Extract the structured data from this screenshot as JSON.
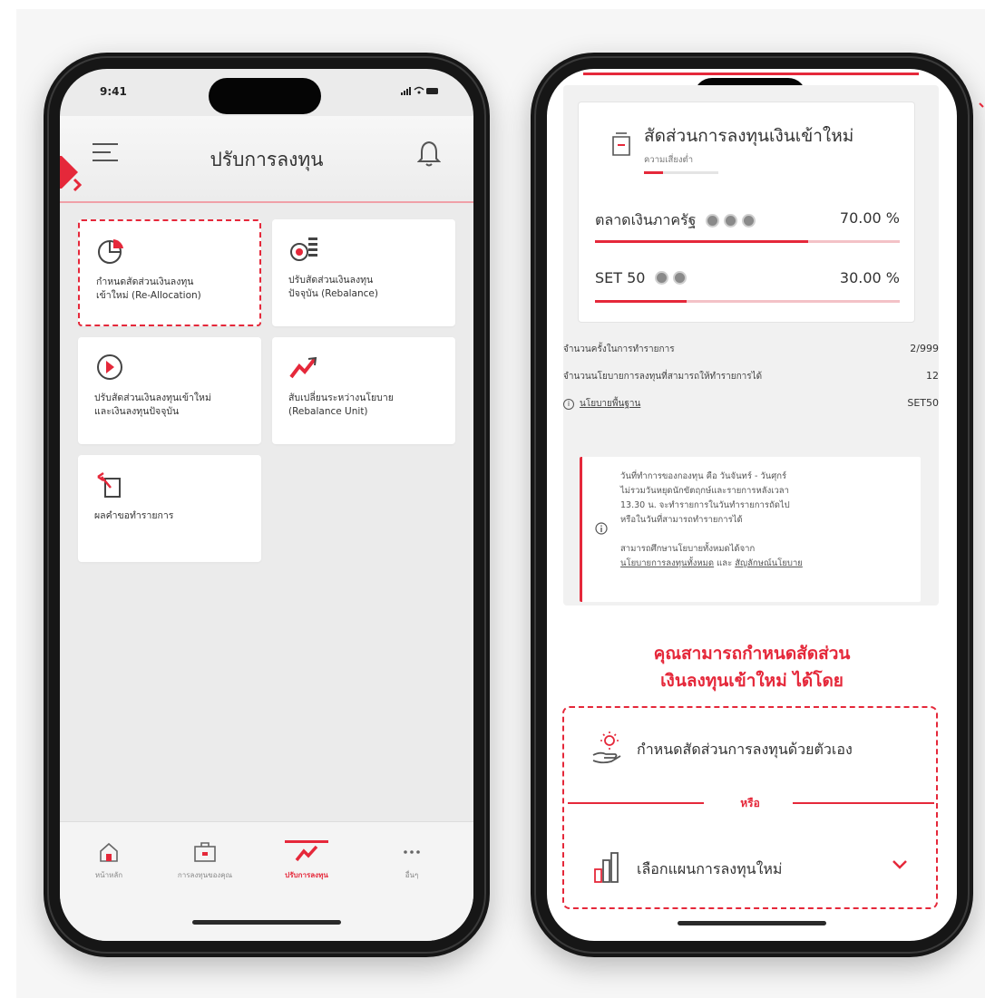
{
  "left_phone": {
    "status_time": "9:41",
    "header_title": "ปรับการลงทุน",
    "tiles": [
      {
        "label_line1": "กำหนดสัดส่วนเงินลงทุน",
        "label_line2": "เข้าใหม่ (Re-Allocation)"
      },
      {
        "label_line1": "ปรับสัดส่วนเงินลงทุน",
        "label_line2": "ปัจจุบัน (Rebalance)"
      },
      {
        "label_line1": "ปรับสัดส่วนเงินลงทุนเข้าใหม่",
        "label_line2": "และเงินลงทุนปัจจุบัน"
      },
      {
        "label_line1": "สับเปลี่ยนระหว่างนโยบาย",
        "label_line2": "(Rebalance Unit)"
      },
      {
        "label_line1": "ผลคำขอทำรายการ",
        "label_line2": ""
      }
    ],
    "nav": [
      {
        "label": "หน้าหลัก"
      },
      {
        "label": "การลงทุนของคุณ"
      },
      {
        "label": "ปรับการลงทุน"
      },
      {
        "label": "อื่นๆ"
      }
    ]
  },
  "right_phone": {
    "card_title": "สัดส่วนการลงทุนเงินเข้าใหม่",
    "card_subtitle": "ความเสี่ยงต่ำ",
    "risk_level": 0.25,
    "funds": [
      {
        "name": "ตลาดเงินภาครัฐ",
        "percent_text": "70.00 %",
        "percent": 70,
        "badges": 3
      },
      {
        "name": "SET 50",
        "percent_text": "30.00 %",
        "percent": 30,
        "badges": 2
      }
    ],
    "stats": [
      {
        "label": "จำนวนครั้งในการทำรายการ",
        "value": "2/999"
      },
      {
        "label": "จำนวนนโยบายการลงทุนที่สามารถให้ทำรายการได้",
        "value": "12"
      },
      {
        "label": "นโยบายพื้นฐาน",
        "value": "SET50"
      }
    ],
    "notice": {
      "line1": "วันที่ทำการของกองทุน คือ วันจันทร์ - วันศุกร์",
      "line2": "ไม่รวมวันหยุดนักขัตฤกษ์และรายการหลังเวลา",
      "line3": "13.30 น. จะทำรายการในวันทำรายการถัดไป",
      "line4": "หรือในวันที่สามารถทำรายการได้",
      "line5": "สามารถศึกษานโยบายทั้งหมดได้จาก",
      "link1": "นโยบายการลงทุนทั้งหมด",
      "and": " และ ",
      "link2": "สัญลักษณ์นโยบาย"
    },
    "cta_line1": "คุณสามารถกำหนดสัดส่วน",
    "cta_line2": "เงินลงทุนเข้าใหม่ ได้โดย",
    "option1": "กำหนดสัดส่วนการลงทุนด้วยตัวเอง",
    "or_text": "หรือ",
    "option2": "เลือกแผนการลงทุนใหม่"
  },
  "colors": {
    "accent": "#e5283a",
    "frame": "#161616"
  }
}
